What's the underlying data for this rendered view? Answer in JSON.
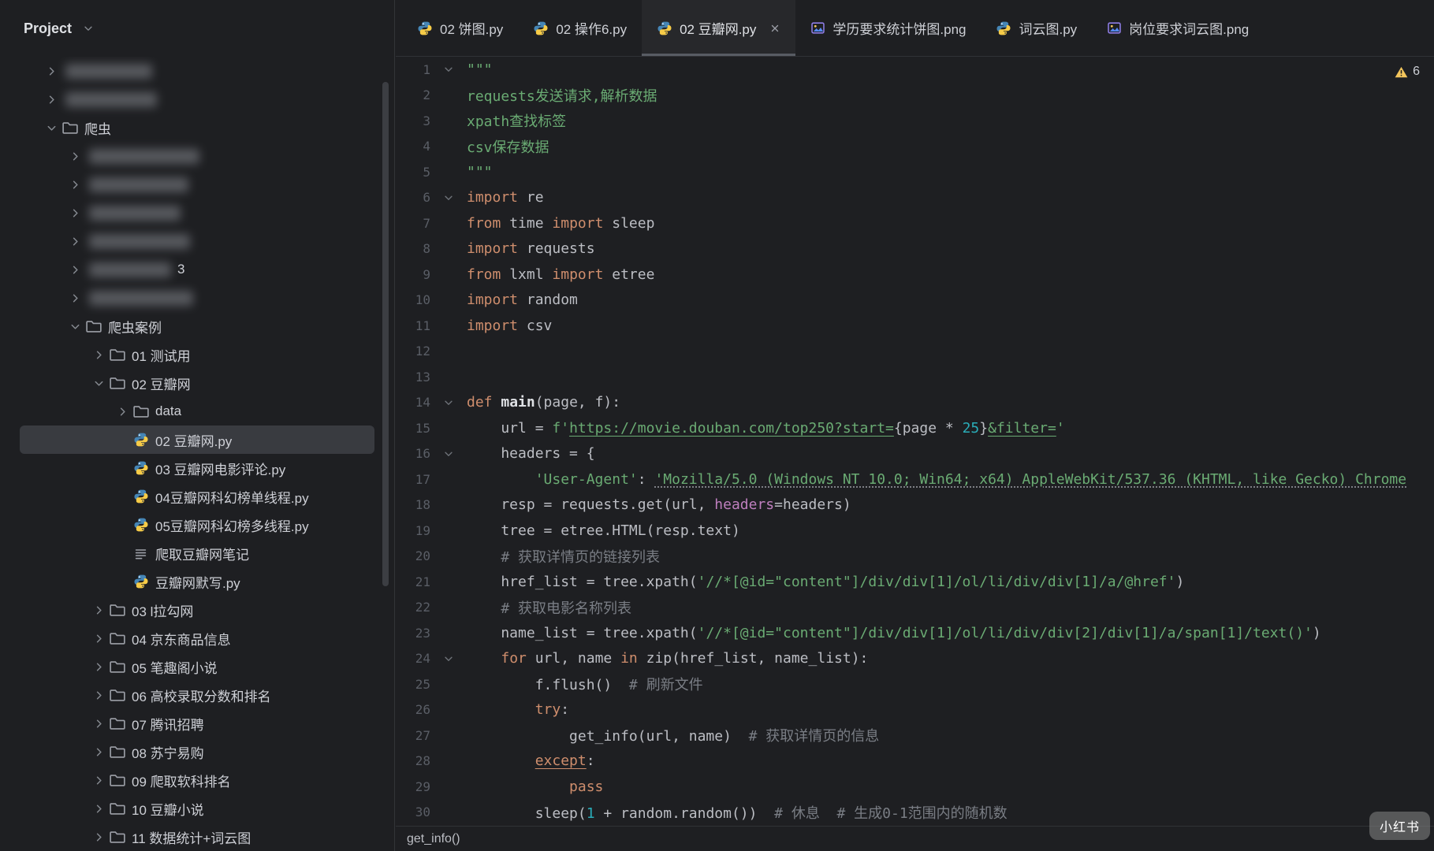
{
  "window": {
    "watermark": "小红书"
  },
  "colors": {
    "bg": "#1E1F22",
    "border": "#323438",
    "selection": "#393B40",
    "text": "#CED0D6",
    "code": "#BCBEC4",
    "keyword": "#CF8E6D",
    "string": "#6AAB73",
    "comment": "#7A7E85",
    "number": "#2AACB8",
    "func": "#DFE1E5",
    "kwarg": "#BE7FBE",
    "lineNumber": "#5A5E66",
    "warning": "#F2C55C"
  },
  "sidebar": {
    "title": "Project",
    "items": [
      {
        "level": 0,
        "type": "folder",
        "state": "collapsed",
        "blurred": true,
        "blob_w": 110,
        "label": ""
      },
      {
        "level": 0,
        "type": "folder",
        "state": "collapsed",
        "blurred": true,
        "blob_w": 116,
        "label": ""
      },
      {
        "level": 0,
        "type": "folder",
        "state": "expanded",
        "label": "爬虫"
      },
      {
        "level": 1,
        "type": "folder",
        "state": "collapsed",
        "blurred": true,
        "blob_w": 140,
        "label": ""
      },
      {
        "level": 1,
        "type": "folder",
        "state": "collapsed",
        "blurred": true,
        "blob_w": 126,
        "label": ""
      },
      {
        "level": 1,
        "type": "folder",
        "state": "collapsed",
        "blurred": true,
        "blob_w": 116,
        "label": ""
      },
      {
        "level": 1,
        "type": "folder",
        "state": "collapsed",
        "blurred": true,
        "blob_w": 128,
        "label": ""
      },
      {
        "level": 1,
        "type": "folder",
        "state": "collapsed",
        "blurred": true,
        "blob_w": 104,
        "label": "",
        "suffix": "3"
      },
      {
        "level": 1,
        "type": "folder",
        "state": "collapsed",
        "blurred": true,
        "blob_w": 132,
        "label": ""
      },
      {
        "level": 1,
        "type": "folder",
        "state": "expanded",
        "label": "爬虫案例"
      },
      {
        "level": 2,
        "type": "folder",
        "state": "collapsed",
        "label": "01 测试用"
      },
      {
        "level": 2,
        "type": "folder",
        "state": "expanded",
        "label": "02 豆瓣网"
      },
      {
        "level": 3,
        "type": "folder",
        "state": "collapsed",
        "label": "data"
      },
      {
        "level": 3,
        "type": "pyfile",
        "label": "02 豆瓣网.py",
        "selected": true
      },
      {
        "level": 3,
        "type": "pyfile",
        "label": "03 豆瓣网电影评论.py"
      },
      {
        "level": 3,
        "type": "pyfile",
        "label": "04豆瓣网科幻榜单线程.py"
      },
      {
        "level": 3,
        "type": "pyfile",
        "label": "05豆瓣网科幻榜多线程.py"
      },
      {
        "level": 3,
        "type": "textfile",
        "label": "爬取豆瓣网笔记"
      },
      {
        "level": 3,
        "type": "pyfile",
        "label": "豆瓣网默写.py"
      },
      {
        "level": 2,
        "type": "folder",
        "state": "collapsed",
        "label": "03 l拉勾网"
      },
      {
        "level": 2,
        "type": "folder",
        "state": "collapsed",
        "label": "04 京东商品信息"
      },
      {
        "level": 2,
        "type": "folder",
        "state": "collapsed",
        "label": "05 笔趣阁小说"
      },
      {
        "level": 2,
        "type": "folder",
        "state": "collapsed",
        "label": "06 高校录取分数和排名"
      },
      {
        "level": 2,
        "type": "folder",
        "state": "collapsed",
        "label": "07 腾讯招聘"
      },
      {
        "level": 2,
        "type": "folder",
        "state": "collapsed",
        "label": "08 苏宁易购"
      },
      {
        "level": 2,
        "type": "folder",
        "state": "collapsed",
        "label": "09 爬取软科排名"
      },
      {
        "level": 2,
        "type": "folder",
        "state": "collapsed",
        "label": "10 豆瓣小说"
      },
      {
        "level": 2,
        "type": "folder",
        "state": "collapsed",
        "label": "11 数据统计+词云图"
      }
    ]
  },
  "tabs": [
    {
      "label": "02 饼图.py",
      "icon": "python"
    },
    {
      "label": "02 操作6.py",
      "icon": "python"
    },
    {
      "label": "02 豆瓣网.py",
      "icon": "python",
      "active": true,
      "closable": true
    },
    {
      "label": "学历要求统计饼图.png",
      "icon": "image"
    },
    {
      "label": "词云图.py",
      "icon": "python"
    },
    {
      "label": "岗位要求词云图.png",
      "icon": "image"
    }
  ],
  "editor": {
    "warning_count": "6",
    "breadcrumb": "get_info()",
    "lines": [
      {
        "n": 1,
        "fold": true,
        "t": [
          [
            "s",
            "\"\"\""
          ]
        ]
      },
      {
        "n": 2,
        "t": [
          [
            "s",
            "requests发送请求,解析数据"
          ]
        ]
      },
      {
        "n": 3,
        "t": [
          [
            "s",
            "xpath查找标签"
          ]
        ]
      },
      {
        "n": 4,
        "t": [
          [
            "s",
            "csv保存数据"
          ]
        ]
      },
      {
        "n": 5,
        "t": [
          [
            "s",
            "\"\"\""
          ]
        ]
      },
      {
        "n": 6,
        "fold": true,
        "t": [
          [
            "k",
            "import"
          ],
          [
            "p",
            " re"
          ]
        ]
      },
      {
        "n": 7,
        "t": [
          [
            "k",
            "from"
          ],
          [
            "p",
            " time "
          ],
          [
            "k",
            "import"
          ],
          [
            "p",
            " sleep"
          ]
        ]
      },
      {
        "n": 8,
        "t": [
          [
            "k",
            "import"
          ],
          [
            "p",
            " requests"
          ]
        ]
      },
      {
        "n": 9,
        "t": [
          [
            "k",
            "from"
          ],
          [
            "p",
            " lxml "
          ],
          [
            "k",
            "import"
          ],
          [
            "p",
            " etree"
          ]
        ]
      },
      {
        "n": 10,
        "t": [
          [
            "k",
            "import"
          ],
          [
            "p",
            " random"
          ]
        ]
      },
      {
        "n": 11,
        "t": [
          [
            "k",
            "import"
          ],
          [
            "p",
            " csv"
          ]
        ]
      },
      {
        "n": 12,
        "t": []
      },
      {
        "n": 13,
        "t": []
      },
      {
        "n": 14,
        "fold": true,
        "t": [
          [
            "k",
            "def "
          ],
          [
            "f",
            "main"
          ],
          [
            "p",
            "(page, f):"
          ]
        ]
      },
      {
        "n": 15,
        "t": [
          [
            "p",
            "    url = "
          ],
          [
            "s",
            "f'"
          ],
          [
            "su",
            "https://movie.douban.com/top250?start="
          ],
          [
            "p",
            "{page * "
          ],
          [
            "n2",
            "25"
          ],
          [
            "p",
            "}"
          ],
          [
            "su",
            "&filter="
          ],
          [
            "s",
            "'"
          ]
        ]
      },
      {
        "n": 16,
        "fold": true,
        "t": [
          [
            "p",
            "    headers = {"
          ]
        ]
      },
      {
        "n": 17,
        "t": [
          [
            "p",
            "        "
          ],
          [
            "s",
            "'User-Agent'"
          ],
          [
            "p",
            ": "
          ],
          [
            "sd",
            "'Mozilla/5.0 (Windows NT 10.0; Win64; x64) AppleWebKit/537.36 (KHTML, like Gecko) Chrome"
          ]
        ]
      },
      {
        "n": 18,
        "t": [
          [
            "p",
            "    resp = requests.get(url, "
          ],
          [
            "kw",
            "headers"
          ],
          [
            "p",
            "=headers)"
          ]
        ]
      },
      {
        "n": 19,
        "t": [
          [
            "p",
            "    tree = etree.HTML(resp.text)"
          ]
        ]
      },
      {
        "n": 20,
        "t": [
          [
            "p",
            "    "
          ],
          [
            "c",
            "# 获取详情页的链接列表"
          ]
        ]
      },
      {
        "n": 21,
        "t": [
          [
            "p",
            "    href_list = tree.xpath("
          ],
          [
            "s",
            "'//*[@id=\"content\"]/div/div[1]/ol/li/div/div[1]/a/@href'"
          ],
          [
            "p",
            ")"
          ]
        ]
      },
      {
        "n": 22,
        "t": [
          [
            "p",
            "    "
          ],
          [
            "c",
            "# 获取电影名称列表"
          ]
        ]
      },
      {
        "n": 23,
        "t": [
          [
            "p",
            "    name_list = tree.xpath("
          ],
          [
            "s",
            "'//*[@id=\"content\"]/div/div[1]/ol/li/div/div[2]/div[1]/a/span[1]/text()'"
          ],
          [
            "p",
            ")"
          ]
        ]
      },
      {
        "n": 24,
        "fold": true,
        "t": [
          [
            "p",
            "    "
          ],
          [
            "k",
            "for"
          ],
          [
            "p",
            " url, name "
          ],
          [
            "k",
            "in"
          ],
          [
            "p",
            " zip(href_list, name_list):"
          ]
        ]
      },
      {
        "n": 25,
        "t": [
          [
            "p",
            "        f.flush()  "
          ],
          [
            "c",
            "# 刷新文件"
          ]
        ]
      },
      {
        "n": 26,
        "t": [
          [
            "p",
            "        "
          ],
          [
            "k",
            "try"
          ],
          [
            "p",
            ":"
          ]
        ]
      },
      {
        "n": 27,
        "t": [
          [
            "p",
            "            get_info(url, name)  "
          ],
          [
            "c",
            "# 获取详情页的信息"
          ]
        ]
      },
      {
        "n": 28,
        "t": [
          [
            "p",
            "        "
          ],
          [
            "ku",
            "except"
          ],
          [
            "p",
            ":"
          ]
        ]
      },
      {
        "n": 29,
        "t": [
          [
            "p",
            "            "
          ],
          [
            "k",
            "pass"
          ]
        ]
      },
      {
        "n": 30,
        "t": [
          [
            "p",
            "        sleep("
          ],
          [
            "n2",
            "1"
          ],
          [
            "p",
            " + random.random())  "
          ],
          [
            "c",
            "# 休息  # 生成0-1范围内的随机数"
          ]
        ]
      }
    ]
  }
}
